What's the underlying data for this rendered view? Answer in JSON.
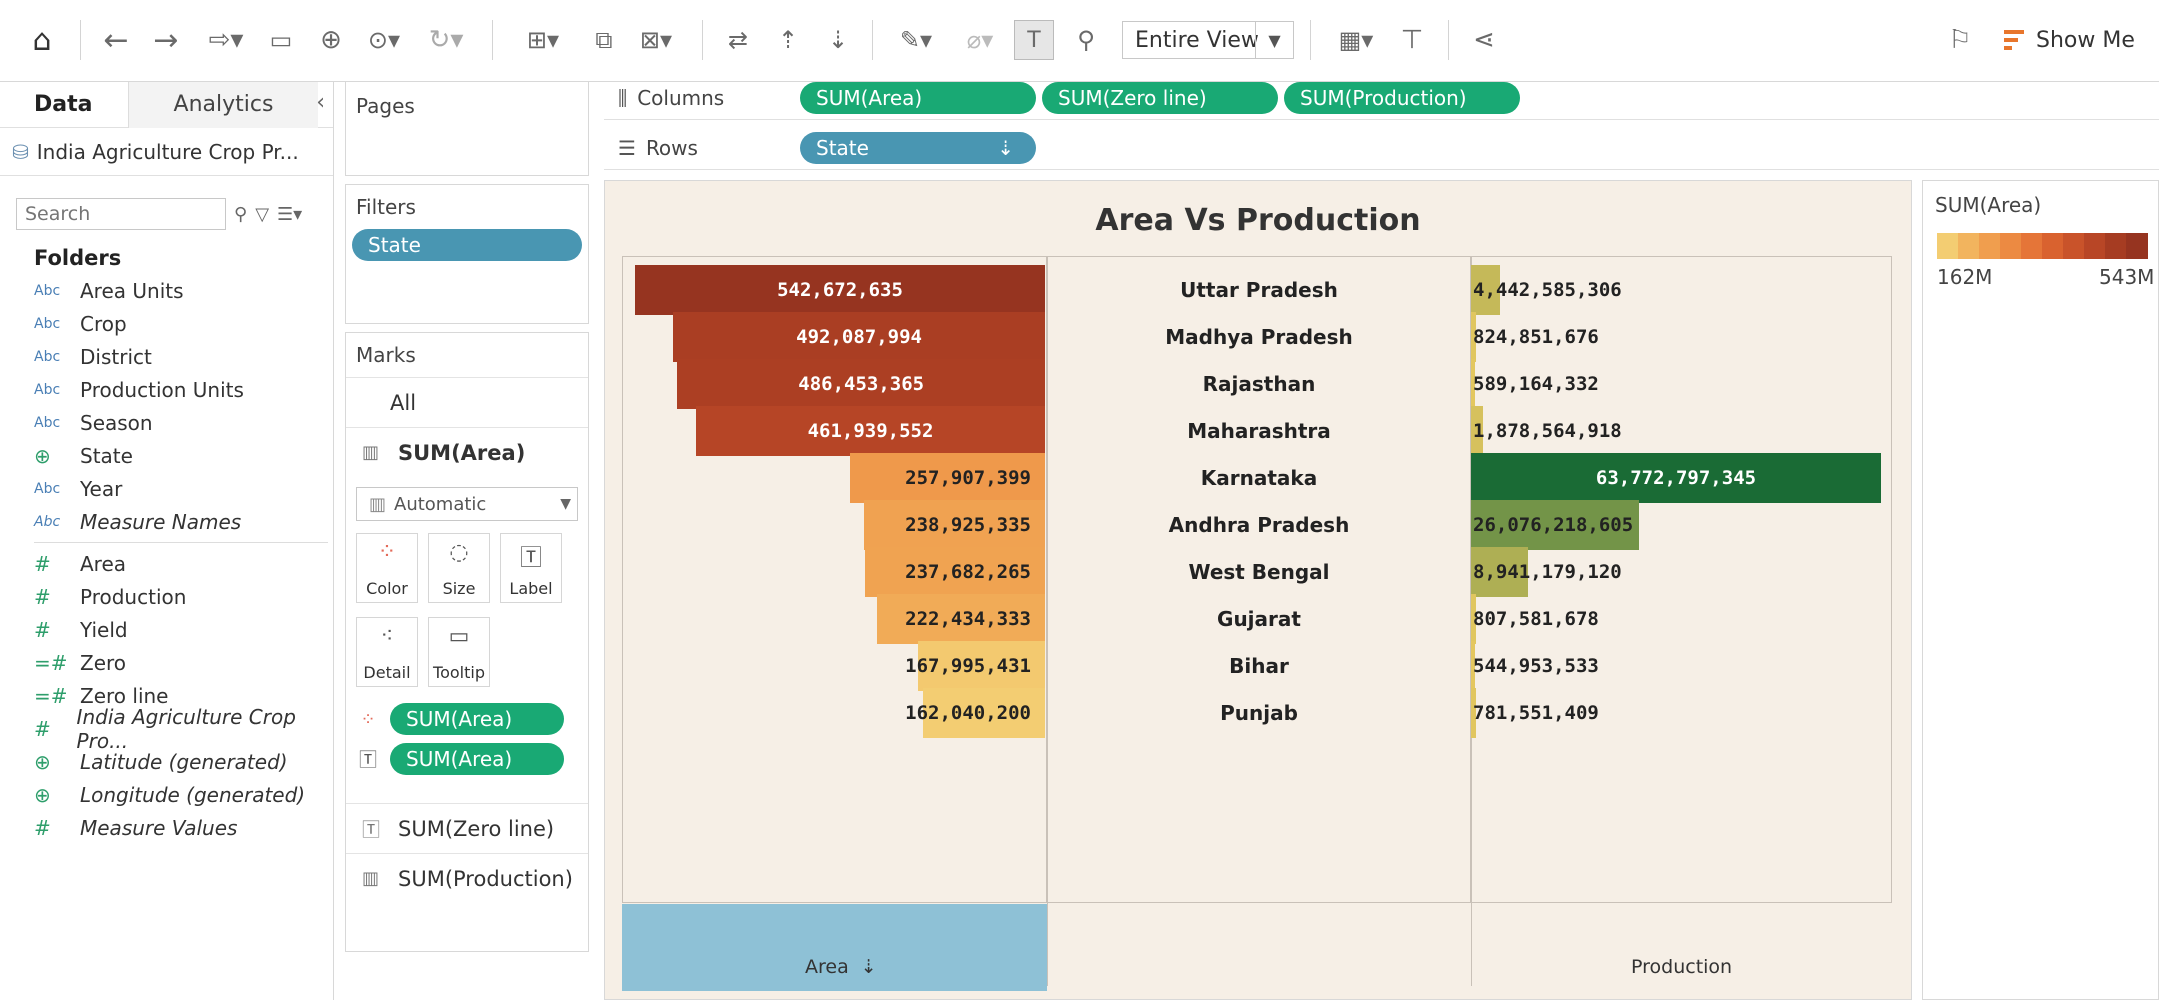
{
  "toolbar": {
    "view_size": "Entire View",
    "show_me": "Show Me"
  },
  "data_pane": {
    "tab_data": "Data",
    "tab_analytics": "Analytics",
    "datasource": "India Agriculture Crop Pr...",
    "search_placeholder": "Search",
    "folders_label": "Folders",
    "dimensions": [
      {
        "type": "Abc",
        "name": "Area Units"
      },
      {
        "type": "Abc",
        "name": "Crop"
      },
      {
        "type": "Abc",
        "name": "District"
      },
      {
        "type": "Abc",
        "name": "Production Units"
      },
      {
        "type": "Abc",
        "name": "Season"
      },
      {
        "type": "geo",
        "name": "State"
      },
      {
        "type": "Abc",
        "name": "Year"
      },
      {
        "type": "Abc",
        "name": "Measure Names"
      }
    ],
    "measures": [
      {
        "type": "#",
        "name": "Area"
      },
      {
        "type": "#",
        "name": "Production"
      },
      {
        "type": "#",
        "name": "Yield"
      },
      {
        "type": "=#",
        "name": "Zero"
      },
      {
        "type": "=#",
        "name": "Zero line"
      },
      {
        "type": "#",
        "name": "India Agriculture Crop Pro..."
      },
      {
        "type": "geo",
        "name": "Latitude (generated)"
      },
      {
        "type": "geo",
        "name": "Longitude (generated)"
      },
      {
        "type": "#",
        "name": "Measure Values"
      }
    ]
  },
  "cards": {
    "pages": "Pages",
    "filters": "Filters",
    "filter_pill": "State",
    "marks": "Marks",
    "marks_all": "All",
    "marks_sum_area": "SUM(Area)",
    "mark_type": "Automatic",
    "btn_color": "Color",
    "btn_size": "Size",
    "btn_label": "Label",
    "btn_detail": "Detail",
    "btn_tooltip": "Tooltip",
    "color_pill": "SUM(Area)",
    "label_pill": "SUM(Area)",
    "marks_zero_line": "SUM(Zero line)",
    "marks_production": "SUM(Production)"
  },
  "shelves": {
    "columns_label": "Columns",
    "rows_label": "Rows",
    "columns": [
      "SUM(Area)",
      "SUM(Zero line)",
      "SUM(Production)"
    ],
    "rows": [
      "State"
    ]
  },
  "legend": {
    "title": "SUM(Area)",
    "min": "162M",
    "max": "543M",
    "ramp_colors": [
      "#f3cd72",
      "#f2b45e",
      "#f09e4e",
      "#ec8a42",
      "#e57538",
      "#d9622f",
      "#c9532a",
      "#b84626",
      "#a63c22",
      "#963420"
    ]
  },
  "chart_data": {
    "type": "bar",
    "title": "Area Vs Production",
    "categories": [
      "Uttar Pradesh",
      "Madhya Pradesh",
      "Rajasthan",
      "Maharashtra",
      "Karnataka",
      "Andhra Pradesh",
      "West Bengal",
      "Gujarat",
      "Bihar",
      "Punjab"
    ],
    "series": [
      {
        "name": "Area",
        "values": [
          542672635,
          492087994,
          486453365,
          461939552,
          257907399,
          238925335,
          237682265,
          222434333,
          167995431,
          162040200
        ],
        "labels": [
          "542,672,635",
          "492,087,994",
          "486,453,365",
          "461,939,552",
          "257,907,399",
          "238,925,335",
          "237,682,265",
          "222,434,333",
          "167,995,431",
          "162,040,200"
        ]
      },
      {
        "name": "Production",
        "values": [
          4442585306,
          824851676,
          589164332,
          1878564918,
          63772797345,
          26076218605,
          8941179120,
          807581678,
          544953533,
          781551409
        ],
        "labels": [
          "4,442,585,306",
          "824,851,676",
          "589,164,332",
          "1,878,564,918",
          "63,772,797,345",
          "26,076,218,605",
          "8,941,179,120",
          "807,581,678",
          "544,953,533",
          "781,551,409"
        ]
      }
    ],
    "xlabel_left": "Area",
    "xlabel_right": "Production",
    "area_color_range": [
      "#f3cd72",
      "#963420"
    ],
    "production_color_range": [
      "#f0cd62",
      "#1a6b35"
    ]
  }
}
